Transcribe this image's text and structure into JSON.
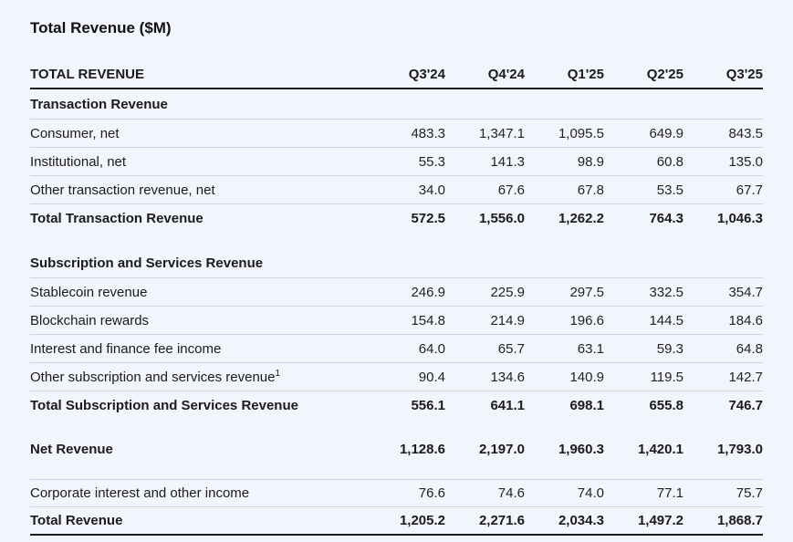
{
  "title": "Total Revenue ($M)",
  "colors": {
    "background": "#f3f5fc",
    "text": "#1b1b1d",
    "divider_light": "#cfd3de",
    "divider_dark": "#1c1c1f"
  },
  "table": {
    "header": {
      "label": "TOTAL REVENUE",
      "columns": [
        "Q3'24",
        "Q4'24",
        "Q1'25",
        "Q2'25",
        "Q3'25"
      ]
    },
    "rows": [
      {
        "type": "section",
        "label": "Transaction Revenue",
        "values": []
      },
      {
        "type": "data",
        "label": "Consumer, net",
        "values": [
          "483.3",
          "1,347.1",
          "1,095.5",
          "649.9",
          "843.5"
        ]
      },
      {
        "type": "data",
        "label": "Institutional, net",
        "values": [
          "55.3",
          "141.3",
          "98.9",
          "60.8",
          "135.0"
        ]
      },
      {
        "type": "data",
        "label": "Other transaction revenue, net",
        "values": [
          "34.0",
          "67.6",
          "67.8",
          "53.5",
          "67.7"
        ]
      },
      {
        "type": "total",
        "label": "Total Transaction Revenue",
        "values": [
          "572.5",
          "1,556.0",
          "1,262.2",
          "764.3",
          "1,046.3"
        ]
      },
      {
        "type": "spacer"
      },
      {
        "type": "section",
        "label": "Subscription and Services Revenue",
        "values": []
      },
      {
        "type": "data",
        "label": "Stablecoin revenue",
        "values": [
          "246.9",
          "225.9",
          "297.5",
          "332.5",
          "354.7"
        ]
      },
      {
        "type": "data",
        "label": "Blockchain rewards",
        "values": [
          "154.8",
          "214.9",
          "196.6",
          "144.5",
          "184.6"
        ]
      },
      {
        "type": "data",
        "label": "Interest and finance fee income",
        "values": [
          "64.0",
          "65.7",
          "63.1",
          "59.3",
          "64.8"
        ]
      },
      {
        "type": "data",
        "label": "Other subscription and services revenue",
        "superscript": "1",
        "values": [
          "90.4",
          "134.6",
          "140.9",
          "119.5",
          "142.7"
        ]
      },
      {
        "type": "total",
        "label": "Total Subscription and Services Revenue",
        "values": [
          "556.1",
          "641.1",
          "698.1",
          "655.8",
          "746.7"
        ]
      },
      {
        "type": "spacer"
      },
      {
        "type": "total",
        "label": "Net Revenue",
        "values": [
          "1,128.6",
          "2,197.0",
          "1,960.3",
          "1,420.1",
          "1,793.0"
        ]
      },
      {
        "type": "spacer"
      },
      {
        "type": "data",
        "label": "Corporate interest and other income",
        "border_top": true,
        "values": [
          "76.6",
          "74.6",
          "74.0",
          "77.1",
          "75.7"
        ]
      },
      {
        "type": "grand_total",
        "label": "Total Revenue",
        "values": [
          "1,205.2",
          "2,271.6",
          "2,034.3",
          "1,497.2",
          "1,868.7"
        ]
      }
    ]
  }
}
